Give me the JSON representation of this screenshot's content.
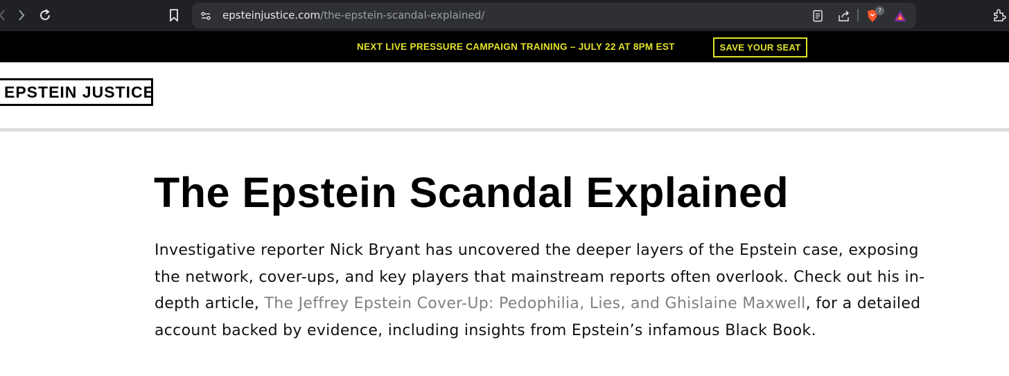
{
  "browser": {
    "url_host": "epsteinjustice.com",
    "url_path": "/the-epstein-scandal-explained/",
    "shields_count": "7",
    "icons": [
      "back-icon",
      "forward-icon",
      "reload-icon",
      "bookmark-icon",
      "site-info-icon",
      "reader-mode-icon",
      "share-icon",
      "brave-shields-icon",
      "brave-rewards-icon",
      "extensions-icon"
    ]
  },
  "promo": {
    "message": "NEXT LIVE PRESSURE CAMPAIGN TRAINING – JULY 22 AT 8PM EST",
    "cta_label": "SAVE YOUR SEAT",
    "accent_color": "#e3e32b"
  },
  "site": {
    "logo_text": "EPSTEIN JUSTICE"
  },
  "article": {
    "title": "The Epstein Scandal Explained",
    "line1": "Investigative reporter Nick Bryant has uncovered the deeper layers of the Epstein case, exposing",
    "line2": "the network, cover-ups, and key players that mainstream reports often overlook. Check out his in-",
    "line3_before": "depth article, ",
    "link_text": "The Jeffrey Epstein Cover-Up: Pedophilia, Lies, and Ghislaine Maxwell",
    "line3_after": ", for a detailed",
    "line4": "account backed by evidence, including insights from Epstein’s infamous Black Book.",
    "link_color": "#808080"
  }
}
